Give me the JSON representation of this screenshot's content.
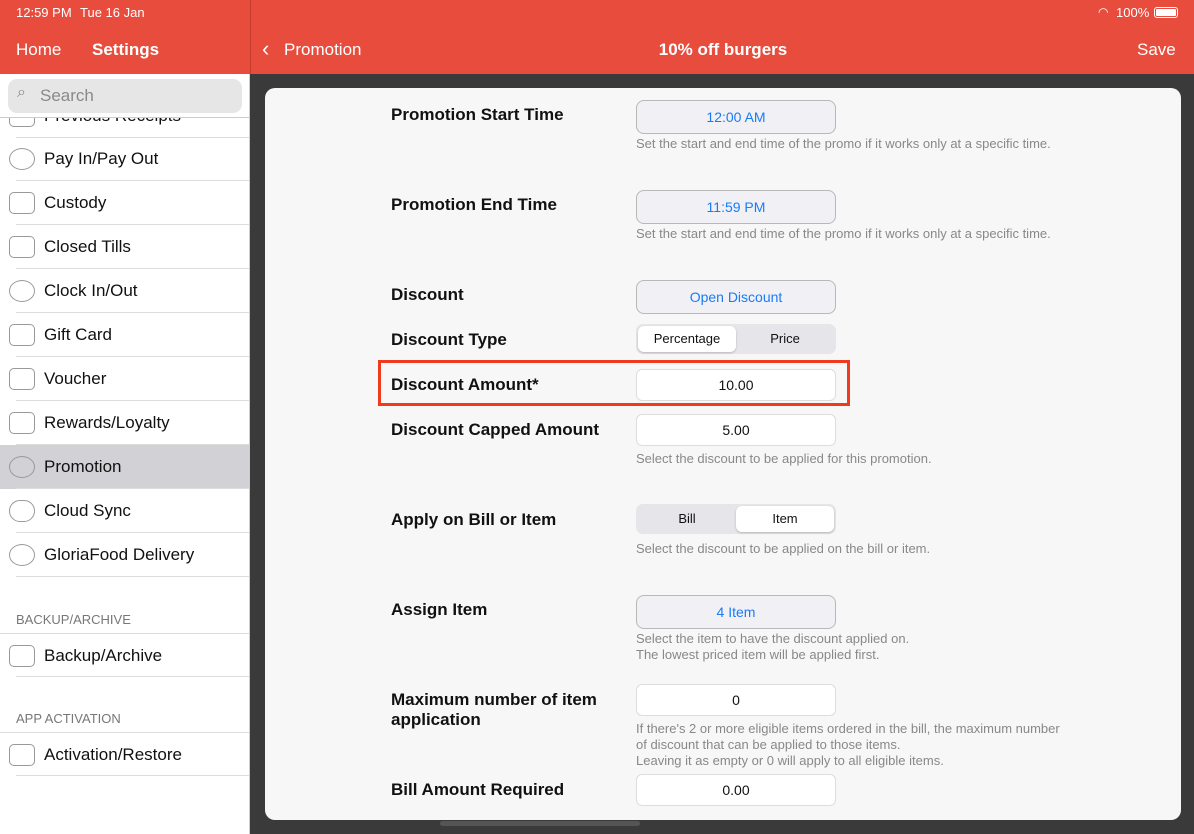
{
  "status": {
    "time": "12:59 PM",
    "date": "Tue 16 Jan",
    "battery": "100%"
  },
  "header": {
    "home": "Home",
    "settings": "Settings",
    "back": "Promotion",
    "title": "10% off burgers",
    "save": "Save"
  },
  "sidebar": {
    "search_placeholder": "Search",
    "items": [
      {
        "label": "Previous Receipts"
      },
      {
        "label": "Pay In/Pay Out"
      },
      {
        "label": "Custody"
      },
      {
        "label": "Closed Tills"
      },
      {
        "label": "Clock In/Out"
      },
      {
        "label": "Gift Card"
      },
      {
        "label": "Voucher"
      },
      {
        "label": "Rewards/Loyalty"
      },
      {
        "label": "Promotion",
        "selected": true
      },
      {
        "label": "Cloud Sync"
      },
      {
        "label": "GloriaFood Delivery"
      }
    ],
    "section_backup": "BACKUP/ARCHIVE",
    "backup": "Backup/Archive",
    "section_activation": "APP ACTIVATION",
    "activation": "Activation/Restore"
  },
  "form": {
    "start_label": "Promotion Start Time",
    "start_value": "12:00 AM",
    "start_hint": "Set the start and end time of the promo if it works only at a specific time.",
    "end_label": "Promotion End Time",
    "end_value": "11:59 PM",
    "end_hint": "Set the start and end time of the promo if it works only at a specific time.",
    "discount_label": "Discount",
    "discount_value": "Open Discount",
    "type_label": "Discount Type",
    "type_options": [
      "Percentage",
      "Price"
    ],
    "type_selected": "Percentage",
    "amount_label": "Discount Amount*",
    "amount_value": "10.00",
    "capped_label": "Discount Capped Amount",
    "capped_value": "5.00",
    "capped_hint": "Select the discount to be applied for this promotion.",
    "apply_label": "Apply on Bill or Item",
    "apply_options": [
      "Bill",
      "Item"
    ],
    "apply_selected": "Item",
    "apply_hint": "Select the discount to be applied on the bill or item.",
    "assign_label": "Assign Item",
    "assign_value": "4 Item",
    "assign_hint": "Select the item to have the discount applied on.\nThe lowest priced item will be applied first.",
    "max_label": "Maximum number of item application",
    "max_value": "0",
    "max_hint": "If there's 2 or more eligible items ordered in the bill, the maximum number of discount that can be applied to those items.\nLeaving it as empty or 0 will apply to all eligible items.",
    "bill_label": "Bill Amount Required",
    "bill_value": "0.00"
  },
  "colors": {
    "accent": "#e84c3d",
    "link": "#1a7cf5",
    "highlight": "#f03a1e"
  }
}
